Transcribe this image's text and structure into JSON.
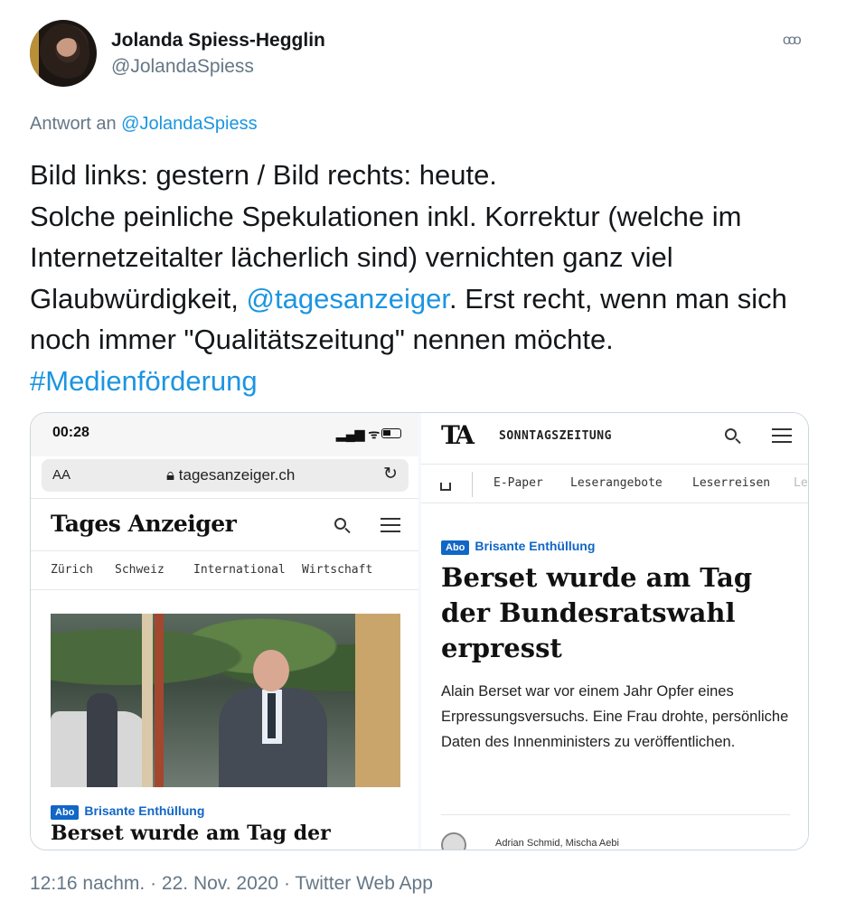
{
  "tweet": {
    "author_name": "Jolanda Spiess-Hegglin",
    "author_handle": "@JolandaSpiess",
    "more_label": "ooo",
    "reply_prefix": "Antwort an",
    "reply_mention": "@JolandaSpiess",
    "text_line1": "Bild links: gestern / Bild rechts: heute.",
    "text_line2": "Solche peinliche Spekulationen inkl. Korrektur (welche im Internetzeitalter lächerlich sind) vernichten ganz viel Glaubwürdigkeit, ",
    "text_mention": "@tagesanzeiger",
    "text_line3": ". Erst recht, wenn man sich noch immer \"Qualitätszeitung\" nennen möchte.",
    "hashtag": "#Medienförderung",
    "footer": "12:16 nachm. · 22. Nov. 2020 · Twitter Web App"
  },
  "left_screenshot": {
    "time": "00:28",
    "url_aa": "AA",
    "url": "tagesanzeiger.ch",
    "logo": "Tages Anzeiger",
    "nav": [
      "Zürich",
      "Schweiz",
      "International",
      "Wirtschaft"
    ],
    "badge": "Abo",
    "kicker": "Brisante Enthüllung",
    "headline": "Berset wurde am Tag der"
  },
  "right_screenshot": {
    "logo": "TA",
    "title": "SONNTAGSZEITUNG",
    "nav": [
      "E-Paper",
      "Leserangebote",
      "Leserreisen",
      "Le"
    ],
    "badge": "Abo",
    "kicker": "Brisante Enthüllung",
    "headline": "Berset wurde am Tag der Bundesratswahl erpresst",
    "lead": "Alain Berset war vor einem Jahr Opfer eines Erpressungsversuchs. Eine Frau drohte, persönliche Daten des Innenministers zu veröffentlichen.",
    "byline": "Adrian Schmid, Mischa Aebi"
  },
  "colors": {
    "link": "#1b95e0",
    "muted": "#657786",
    "abo": "#1166c6"
  },
  "icons": [
    "avatar",
    "more-icon",
    "lock-icon",
    "reload-icon",
    "search-icon",
    "menu-icon",
    "home-icon"
  ]
}
